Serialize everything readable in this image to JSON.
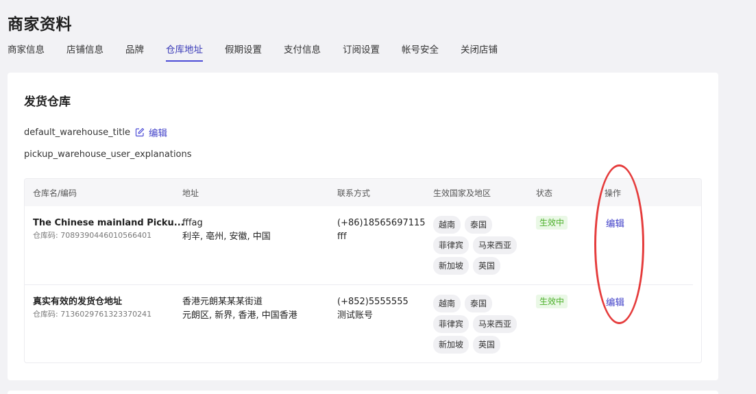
{
  "header": {
    "title": "商家资料"
  },
  "tabs": [
    {
      "label": "商家信息",
      "active": false
    },
    {
      "label": "店铺信息",
      "active": false
    },
    {
      "label": "品牌",
      "active": false
    },
    {
      "label": "仓库地址",
      "active": true
    },
    {
      "label": "假期设置",
      "active": false
    },
    {
      "label": "支付信息",
      "active": false
    },
    {
      "label": "订阅设置",
      "active": false
    },
    {
      "label": "帐号安全",
      "active": false
    },
    {
      "label": "关闭店铺",
      "active": false
    }
  ],
  "section": {
    "title": "发货仓库",
    "default_title": "default_warehouse_title",
    "default_edit": "编辑",
    "explanation": "pickup_warehouse_user_explanations"
  },
  "table": {
    "columns": [
      "仓库名/编码",
      "地址",
      "联系方式",
      "生效国家及地区",
      "状态",
      "操作"
    ],
    "rows": [
      {
        "name": "The Chinese mainland Picku...",
        "code": "仓库码: 7089390446010566401",
        "address_line1": "fffag",
        "address_line2": "利辛, 亳州, 安徽, 中国",
        "contact_line1": "(+86)18565697115",
        "contact_line2": "fff",
        "countries": [
          "越南",
          "泰国",
          "菲律宾",
          "马来西亚",
          "新加坡",
          "英国"
        ],
        "status": "生效中",
        "action": "编辑"
      },
      {
        "name": "真实有效的发货仓地址",
        "code": "仓库码: 7136029761323370241",
        "address_line1": "香港元朗某某某街道",
        "address_line2": "元朗区, 新界, 香港, 中国香港",
        "contact_line1": "(+852)5555555",
        "contact_line2": "测试账号",
        "countries": [
          "越南",
          "泰国",
          "菲律宾",
          "马来西亚",
          "新加坡",
          "英国"
        ],
        "status": "生效中",
        "action": "编辑"
      }
    ]
  },
  "colors": {
    "accent": "#3f3fc8",
    "status_green": "#4caf2a",
    "highlight_red": "#e53c3c"
  },
  "icons": {
    "edit": "edit-icon"
  }
}
